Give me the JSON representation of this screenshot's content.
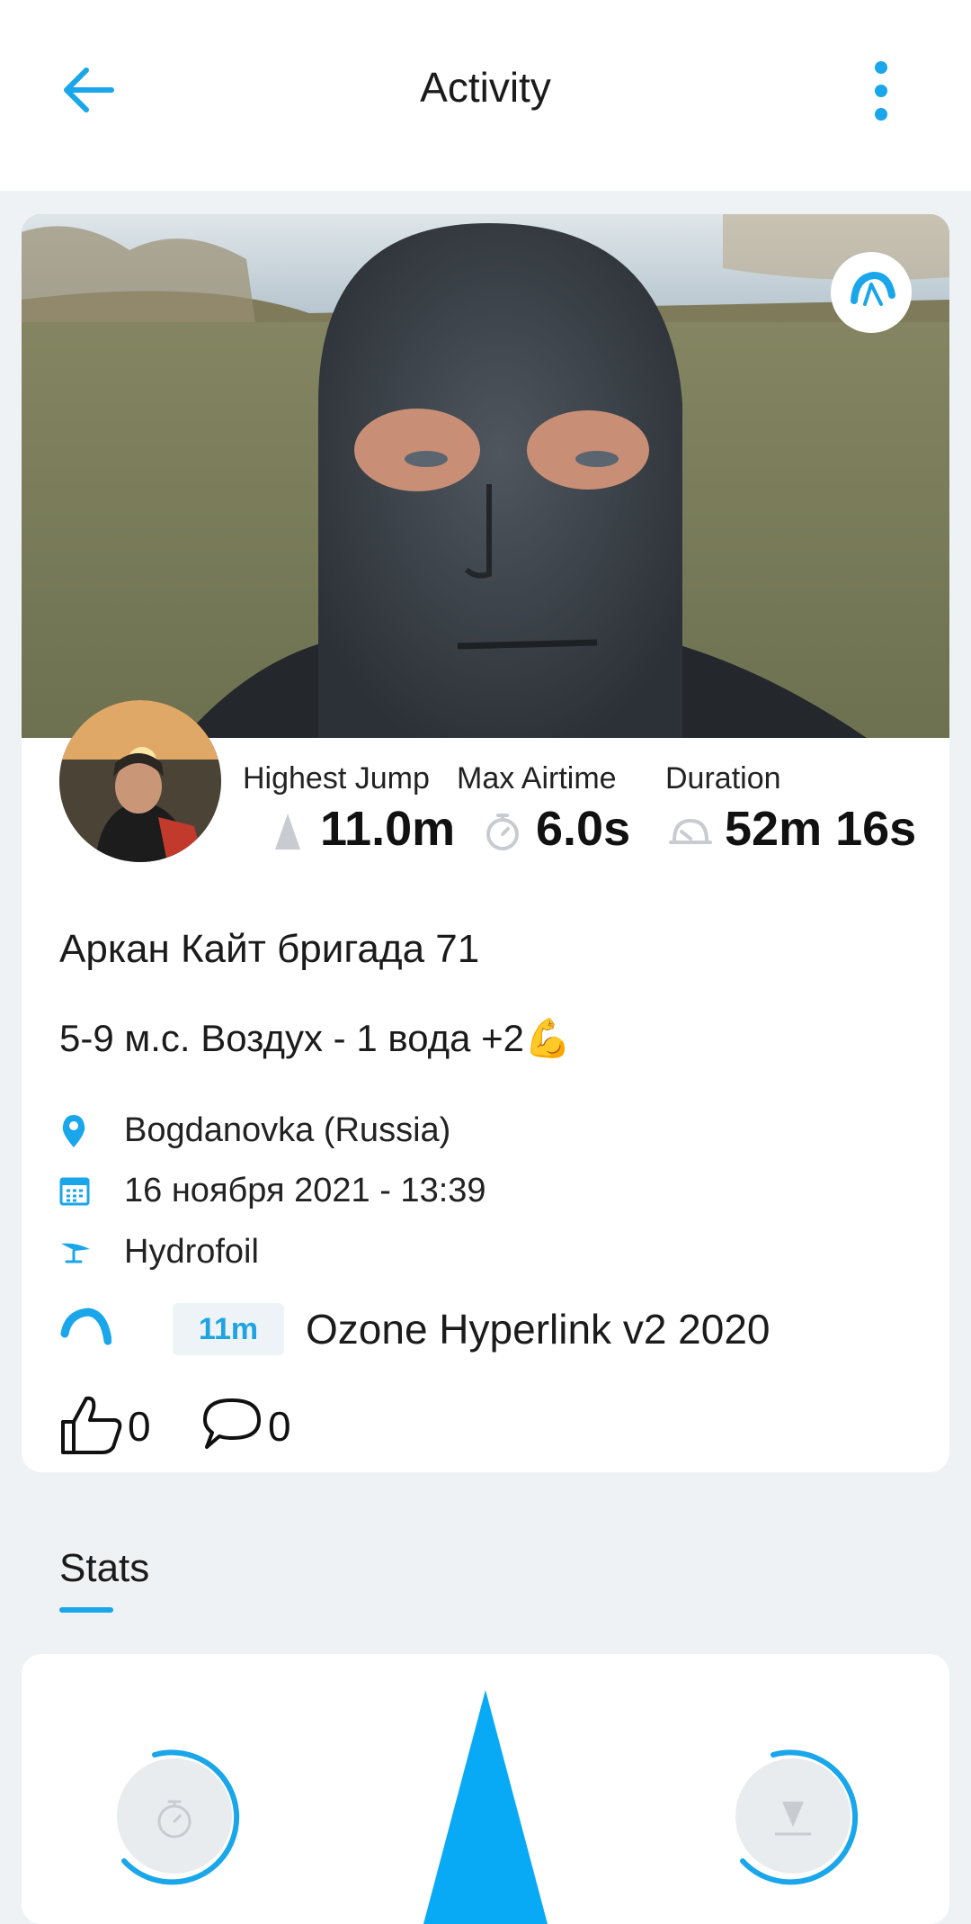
{
  "header": {
    "title": "Activity"
  },
  "colors": {
    "accent": "#1aa6ea",
    "card": "#ffffff",
    "background": "#eef2f5"
  },
  "metrics": {
    "highest_jump": {
      "label": "Highest Jump",
      "value": "11.0m",
      "icon": "jump-height-icon"
    },
    "max_airtime": {
      "label": "Max Airtime",
      "value": "6.0s",
      "icon": "stopwatch-icon"
    },
    "duration": {
      "label": "Duration",
      "value": "52m 16s",
      "icon": "duration-icon"
    }
  },
  "session": {
    "title": "Аркан Кайт бригада 71",
    "description": "5-9 м.с. Воздух - 1 вода +2💪",
    "location": "Bogdanovka (Russia)",
    "date": "16 ноября 2021 - 13:39",
    "discipline": "Hydrofoil"
  },
  "gear": {
    "size": "11m",
    "kite": "Ozone Hyperlink v2 2020"
  },
  "social": {
    "likes": "0",
    "comments": "0"
  },
  "tabs": {
    "stats": "Stats"
  }
}
